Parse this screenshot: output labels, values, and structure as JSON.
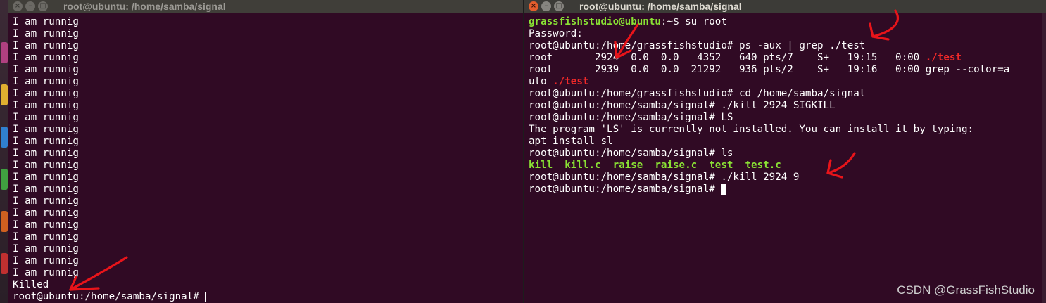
{
  "left_window": {
    "title": "root@ubuntu: /home/samba/signal",
    "buttons": [
      "×",
      "–",
      "□"
    ],
    "lines": [
      "I am runnig",
      "I am runnig",
      "I am runnig",
      "I am runnig",
      "I am runnig",
      "I am runnig",
      "I am runnig",
      "I am runnig",
      "I am runnig",
      "I am runnig",
      "I am runnig",
      "I am runnig",
      "I am runnig",
      "I am runnig",
      "I am runnig",
      "I am runnig",
      "I am runnig",
      "I am runnig",
      "I am runnig",
      "I am runnig",
      "I am runnig",
      "I am runnig",
      "Killed"
    ],
    "prompt": "root@ubuntu:/home/samba/signal# "
  },
  "right_window": {
    "title": "root@ubuntu: /home/samba/signal",
    "buttons": [
      "×",
      "–",
      "□"
    ],
    "lines": {
      "l1_user": "grassfishstudio@ubuntu",
      "l1_rest": ":~$ su root",
      "l2": "Password:",
      "l3": "root@ubuntu:/home/grassfishstudio# ps -aux | grep ./test",
      "l4_main": "root       2924  0.0  0.0   4352   640 pts/7    S+   19:15   0:00 ",
      "l4_hl": "./test",
      "l5": "root       2939  0.0  0.0  21292   936 pts/2    S+   19:16   0:00 grep --color=a",
      "l6_main": "uto ",
      "l6_hl": "./test",
      "l7": "root@ubuntu:/home/grassfishstudio# cd /home/samba/signal",
      "l8": "root@ubuntu:/home/samba/signal# ./kill 2924 SIGKILL",
      "l9": "root@ubuntu:/home/samba/signal# LS",
      "l10": "The program 'LS' is currently not installed. You can install it by typing:",
      "l11": "apt install sl",
      "l12": "root@ubuntu:/home/samba/signal# ls",
      "l13": "kill  kill.c  raise  raise.c  test  test.c",
      "l14": "root@ubuntu:/home/samba/signal# ./kill 2924 9",
      "l15": "root@ubuntu:/home/samba/signal# "
    }
  },
  "watermark": "CSDN @GrassFishStudio",
  "colors": {
    "terminal_bg": "#300a24",
    "green": "#8ae234",
    "red": "#ef2929",
    "annotation_red": "#e8141a"
  },
  "icons": [
    "close-icon",
    "minimize-icon",
    "maximize-icon",
    "text-cursor"
  ]
}
